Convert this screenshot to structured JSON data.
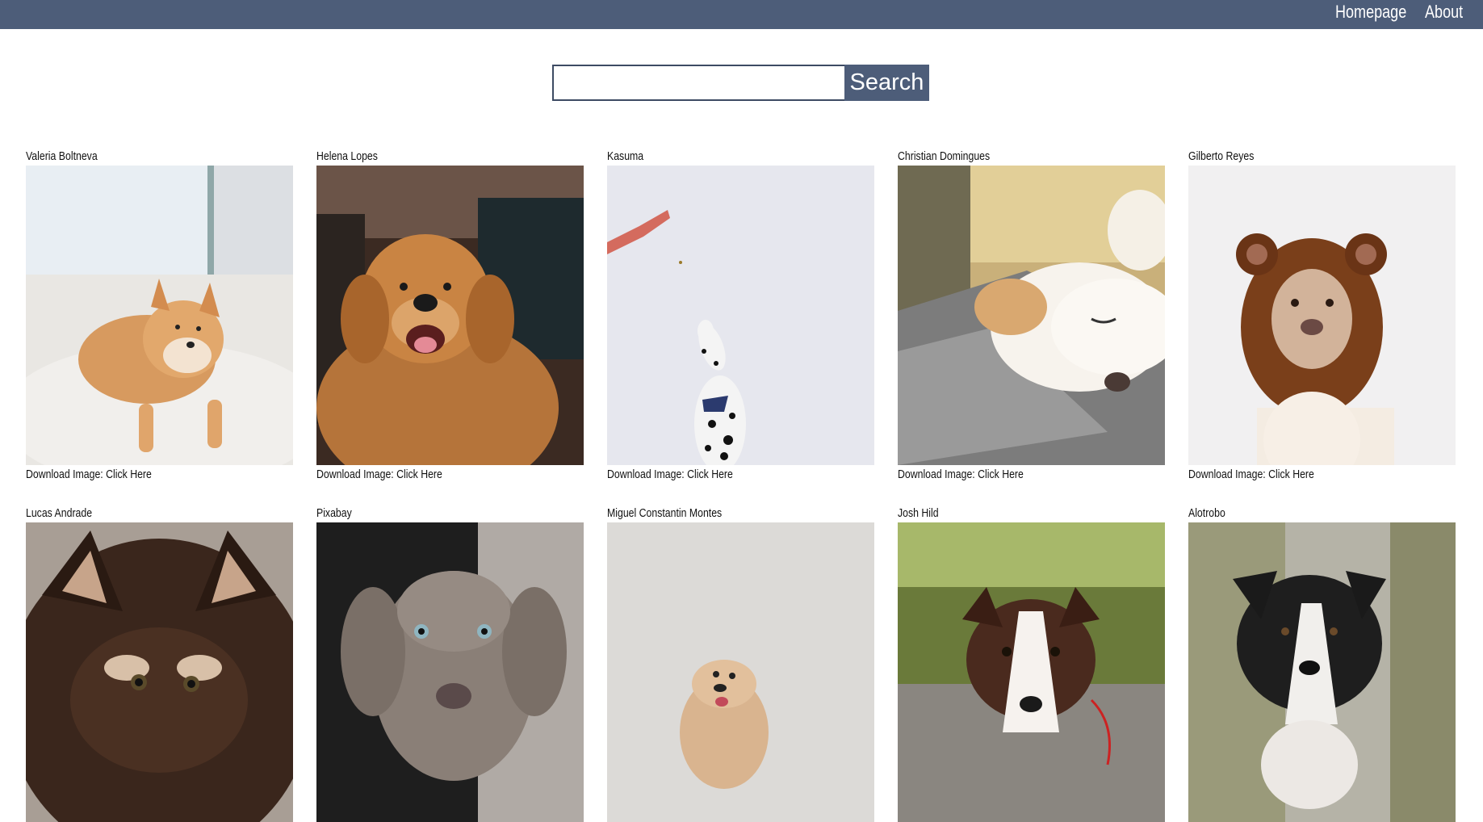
{
  "nav": {
    "home": "Homepage",
    "about": "About"
  },
  "search": {
    "value": "",
    "placeholder": "",
    "button": "Search"
  },
  "colors": {
    "header": "#4d5d79",
    "button": "#4d5d79",
    "border": "#3d4b63"
  },
  "download_prefix": "Download Image: ",
  "download_link": "Click Here",
  "photos": [
    {
      "author": "Valeria Boltneva",
      "subject": "shiba-inu-puppy-on-white-rug"
    },
    {
      "author": "Helena Lopes",
      "subject": "smiling-golden-retriever"
    },
    {
      "author": "Kasuma",
      "subject": "dalmatian-catching-treat"
    },
    {
      "author": "Christian Domingues",
      "subject": "sleeping-dog-on-blanket"
    },
    {
      "author": "Gilberto Reyes",
      "subject": "dog-in-bear-hat"
    },
    {
      "author": "Lucas Andrade",
      "subject": "fluffy-puppy-closeup"
    },
    {
      "author": "Pixabay",
      "subject": "weimaraner-puppy"
    },
    {
      "author": "Miguel Constantin Montes",
      "subject": "small-fluffy-dog-looking-up"
    },
    {
      "author": "Josh Hild",
      "subject": "border-collie-puppy-on-grass"
    },
    {
      "author": "Alotrobo",
      "subject": "border-collie-running"
    }
  ]
}
